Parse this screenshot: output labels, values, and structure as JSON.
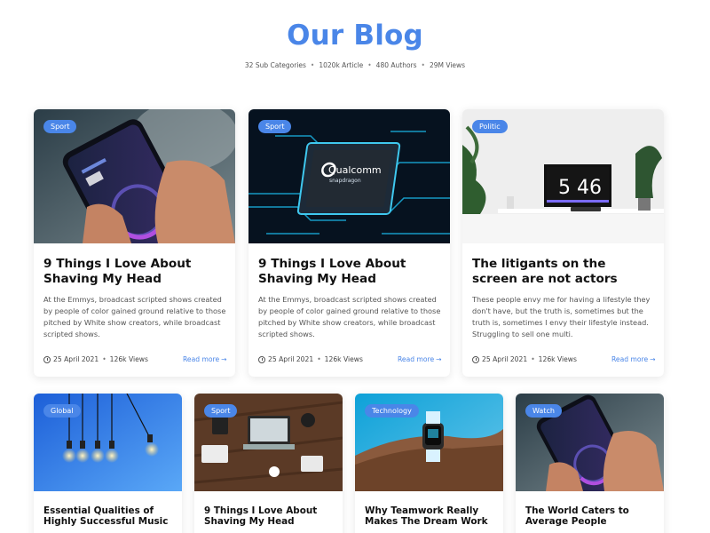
{
  "page": {
    "title": "Our Blog",
    "stats": [
      "32 Sub Categories",
      "1020k Article",
      "480 Authors",
      "29M Views"
    ]
  },
  "colors": {
    "accent": "#4a86e8",
    "title": "#111111",
    "text": "#555555"
  },
  "featured": [
    {
      "category": "Sport",
      "title": "9 Things I Love About Shaving My Head",
      "excerpt": "At the Emmys, broadcast scripted shows created by people of color gained ground relative to those pitched by White show creators, while broadcast scripted shows.",
      "date": "25 April 2021",
      "views": "126k Views",
      "read_more": "Read more",
      "image": "phone-speedtest"
    },
    {
      "category": "Sport",
      "title": "9 Things I Love About Shaving My Head",
      "excerpt": "At the Emmys, broadcast scripted shows created by people of color gained ground relative to those pitched by White show creators, while broadcast scripted shows.",
      "date": "25 April 2021",
      "views": "126k Views",
      "read_more": "Read more",
      "image": "qualcomm-chip"
    },
    {
      "category": "Politic",
      "title": "The litigants on the screen are not actors",
      "excerpt": "These people envy me for having a lifestyle they don't have, but the truth is, sometimes but the truth is, sometimes I envy their lifestyle instead. Struggling to sell one multi.",
      "date": "25 April 2021",
      "views": "126k Views",
      "read_more": "Read more",
      "image": "desk-monitor",
      "monitor_text": "5 46"
    }
  ],
  "more": [
    {
      "category": "Global",
      "title": "Essential Qualities of Highly Successful Music",
      "image": "light-bulbs"
    },
    {
      "category": "Sport",
      "title": "9 Things I Love About Shaving My Head",
      "image": "desk-topdown"
    },
    {
      "category": "Technology",
      "title": "Why Teamwork Really Makes The Dream Work",
      "image": "smartwatch"
    },
    {
      "category": "Watch",
      "title": "The World Caters to Average People",
      "image": "phone-speedtest"
    }
  ],
  "chip": {
    "brand": "Qualcomm",
    "model": "snapdragon"
  }
}
